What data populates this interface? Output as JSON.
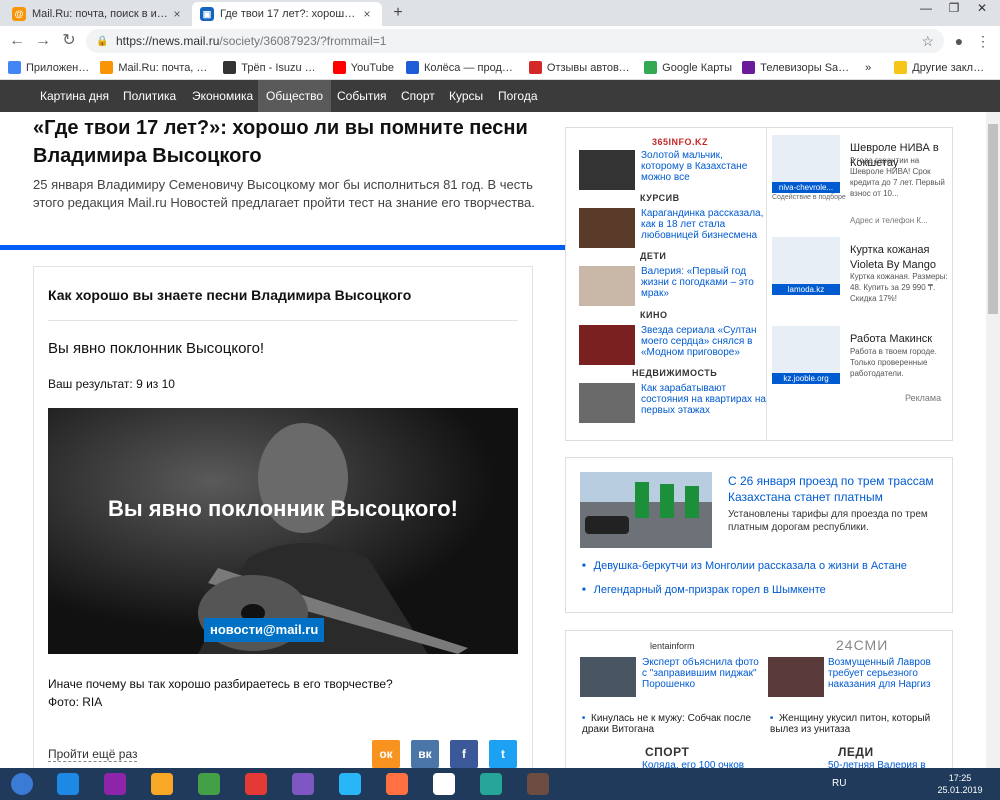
{
  "browser": {
    "tabs": [
      {
        "title": "Mail.Ru: почта, поиск в интернете"
      },
      {
        "title": "Где твои 17 лет?: хорошо ли вы помните песни"
      }
    ],
    "url_main": "https://news.mail.ru",
    "url_path": "/society/36087923/?frommail=1",
    "bookmarks": [
      {
        "label": "Приложения",
        "color": "#4285f4"
      },
      {
        "label": "Mail.Ru: почта, поиск",
        "color": "#f89406"
      },
      {
        "label": "Трёп - Isuzu & Opel",
        "color": "#333333"
      },
      {
        "label": "YouTube",
        "color": "#ff0000"
      },
      {
        "label": "Колёса — продажа",
        "color": "#1e5bd7"
      },
      {
        "label": "Отзывы автовладельц",
        "color": "#d42828"
      },
      {
        "label": "Google Карты",
        "color": "#34a853"
      },
      {
        "label": "Телевизоры Samsung",
        "color": "#6a1b9a"
      },
      {
        "label": "»",
        "color": ""
      },
      {
        "label": "Другие закладки",
        "color": "#f5c518"
      }
    ]
  },
  "sitenav": [
    "Картина дня",
    "Политика",
    "Экономика",
    "Общество",
    "События",
    "Спорт",
    "Курсы",
    "Погода"
  ],
  "article": {
    "title": "«Где твои 17 лет?»: хорошо ли вы помните песни Владимира Высоцкого",
    "lead": "25 января Владимиру Семеновичу Высоцкому мог бы исполниться 81 год. В честь этого редакция Mail.ru Новостей предлагает пройти тест на знание его творчества."
  },
  "quiz": {
    "title": "Как хорошо вы знаете песни Владимира Высоцкого",
    "verdict": "Вы явно поклонник Высоцкого!",
    "result": "Ваш результат: 9 из 10",
    "image_overlay": "Вы явно поклонник Высоцкого!",
    "image_brand": "новости@mail.ru",
    "text1": "Иначе почему вы так хорошо разбираетесь в его творчестве?",
    "text2": "Фото: RIA",
    "retry": "Пройти ещё раз",
    "share": [
      {
        "label": "ок",
        "color": "#f7931e"
      },
      {
        "label": "вк",
        "color": "#4a76a8"
      },
      {
        "label": "f",
        "color": "#3b5998"
      },
      {
        "label": "t",
        "color": "#1da1f2"
      }
    ]
  },
  "news_block1": {
    "source": "365info.kz",
    "items": [
      {
        "label": "",
        "text": "Золотой мальчик, которому в Казахстане можно все",
        "color": "#333333"
      },
      {
        "label": "КУРСИВ",
        "text": "Карагандинка рассказала, как в 18 лет стала любовницей бизнесмена",
        "color": "#5a3b2a"
      },
      {
        "label": "ДЕТИ",
        "text": "Валерия: «Первый год жизни с погодками – это мрак»",
        "color": "#c9b8a8"
      },
      {
        "label": "КИНО",
        "text": "Звезда сериала «Султан моего сердца» снялся в «Модном приговоре»",
        "color": "#7a2020"
      },
      {
        "label": "НЕДВИЖИМОСТЬ",
        "text": "Как зарабатывают состояния на квартирах на первых этажах",
        "color": "#6a6a6a"
      }
    ]
  },
  "ads": {
    "items": [
      {
        "title": "Шевроле НИВА в Кокшетау",
        "caption": "niva-chevrole...",
        "sub": "Содействие в подборе",
        "desc": "2 года гарантии на Шевроле НИВА! Срок кредита до 7 лет. Первый взнос от 10...",
        "extra": "Адрес и телефон  К..."
      },
      {
        "title": "Куртка кожаная Violeta By Mango",
        "caption": "lamoda.kz",
        "sub": "",
        "desc": "Куртка кожаная. Размеры: 48. Купить за 29 990 ₸. Скидка 17%!",
        "extra": ""
      },
      {
        "title": "Работа Макинск",
        "caption": "kz.jooble.org",
        "sub": "",
        "desc": "Работа в твоем городе. Только проверенные работодатели.",
        "extra": ""
      }
    ],
    "label": "Реклама"
  },
  "featured": {
    "title": "С 26 января проезд по трем трассам Казахстана станет платным",
    "desc": "Установлены тарифы для проезда по трем платным дорогам республики.",
    "bullets": [
      "Девушка-беркутчи из Монголии рассказала о жизни в Астане",
      "Легендарный дом-призрак горел в Шымкенте"
    ]
  },
  "news_block3": {
    "source_left": "lentainform",
    "source_right": "24СМИ",
    "left_item": "Эксперт объяснила фото с \"заправившим пиджак\" Порошенко",
    "right_item": "Возмущенный Лавров требует серьезного наказания для Наргиз",
    "left_bullet": "Кинулась не к мужу: Собчак после драки Витогана",
    "right_bullet": "Женщину укусил питон, который вылез из унитаза",
    "label_left": "СПОРТ",
    "label_right": "ЛЕДИ",
    "left_more": "Коляда, его 100 очков",
    "right_more": "50-летняя Валерия в"
  },
  "taskbar": {
    "lang": "RU",
    "time": "17:25",
    "date": "25.01.2019",
    "apps": [
      {
        "name": "ie",
        "color": "#1e88e5"
      },
      {
        "name": "winrar",
        "color": "#8e24aa"
      },
      {
        "name": "explorer",
        "color": "#f9a825"
      },
      {
        "name": "chrome",
        "color": "#43a047"
      },
      {
        "name": "opera",
        "color": "#e53935"
      },
      {
        "name": "vs",
        "color": "#7e57c2"
      },
      {
        "name": "media",
        "color": "#29b6f6"
      },
      {
        "name": "firefox",
        "color": "#ff7043"
      },
      {
        "name": "yandex",
        "color": "#ffffff"
      },
      {
        "name": "mailagent",
        "color": "#26a69a"
      },
      {
        "name": "app",
        "color": "#6d4c41"
      }
    ]
  }
}
